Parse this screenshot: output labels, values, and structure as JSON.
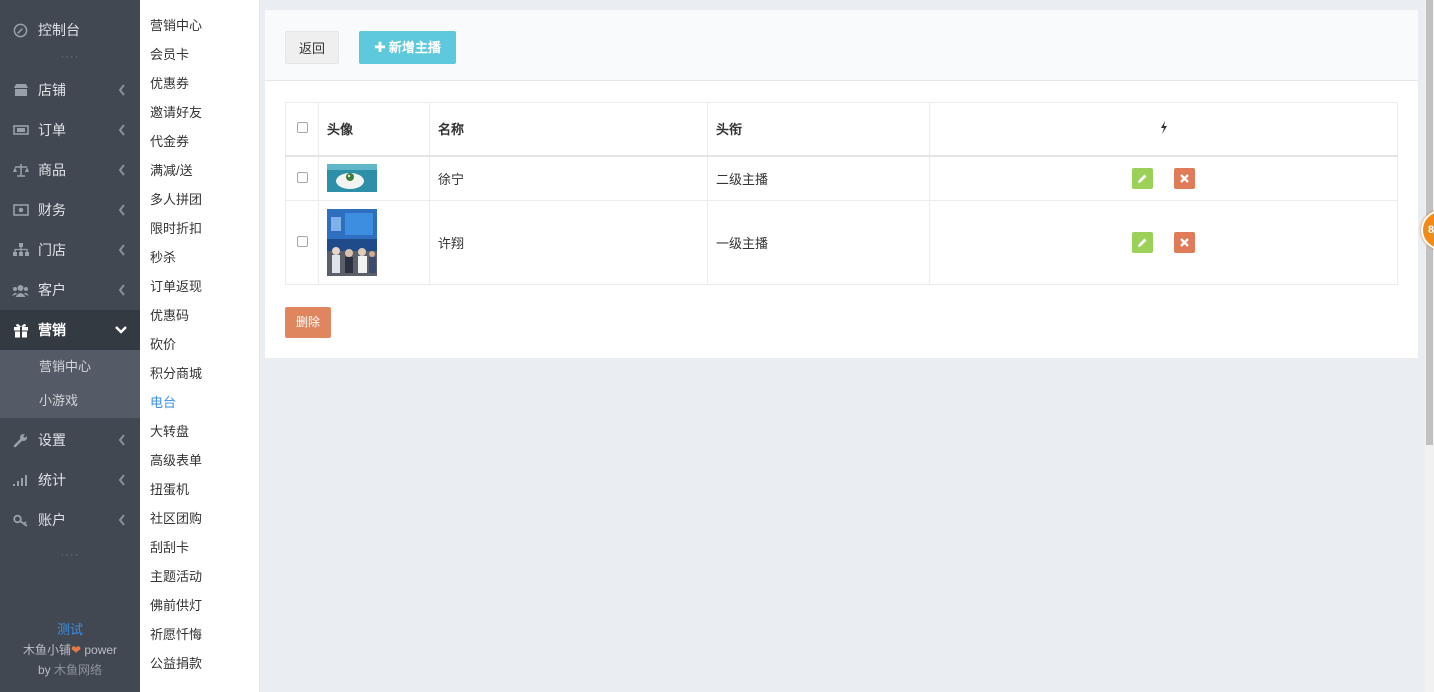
{
  "sidebar": {
    "console": "控制台",
    "dots_top": "····",
    "items": [
      {
        "label": "店铺",
        "icon": "shop-icon"
      },
      {
        "label": "订单",
        "icon": "ticket-icon"
      },
      {
        "label": "商品",
        "icon": "scale-icon"
      },
      {
        "label": "财务",
        "icon": "money-icon"
      },
      {
        "label": "门店",
        "icon": "sitemap-icon"
      },
      {
        "label": "客户",
        "icon": "users-icon"
      }
    ],
    "active": {
      "label": "营销",
      "icon": "gift-icon"
    },
    "sub_items": [
      "营销中心",
      "小游戏"
    ],
    "items_after": [
      {
        "label": "设置",
        "icon": "wrench-icon"
      },
      {
        "label": "统计",
        "icon": "signal-icon"
      },
      {
        "label": "账户",
        "icon": "key-icon"
      }
    ],
    "dots_bottom": "····",
    "footer": {
      "test": "测试",
      "brand": "木鱼小铺",
      "power": " power",
      "by": "by ",
      "company": "木鱼网络"
    }
  },
  "subnav": {
    "items": [
      "营销中心",
      "会员卡",
      "优惠券",
      "邀请好友",
      "代金券",
      "满减/送",
      "多人拼团",
      "限时折扣",
      "秒杀",
      "订单返现",
      "优惠码",
      "砍价",
      "积分商城",
      "电台",
      "大转盘",
      "高级表单",
      "扭蛋机",
      "社区团购",
      "刮刮卡",
      "主题活动",
      "佛前供灯",
      "祈愿忏悔",
      "公益捐款"
    ],
    "active": "电台"
  },
  "toolbar": {
    "back_label": "返回",
    "add_label": "新增主播"
  },
  "table": {
    "headers": {
      "avatar": "头像",
      "name": "名称",
      "title": "头衔"
    },
    "rows": [
      {
        "name": "徐宁",
        "title": "二级主播"
      },
      {
        "name": "许翔",
        "title": "一级主播"
      }
    ]
  },
  "delete_label": "删除",
  "badge": "8"
}
